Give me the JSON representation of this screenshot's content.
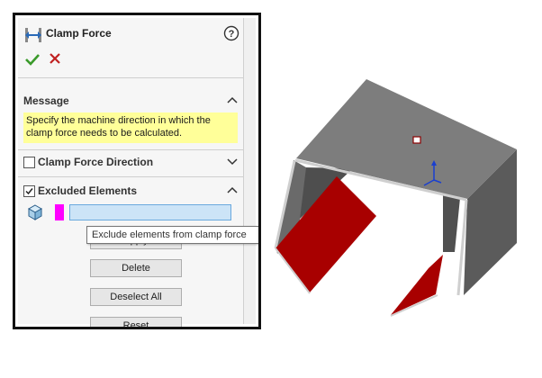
{
  "panel": {
    "title": "Clamp Force",
    "title_icon": "clamp-force-icon",
    "help_icon": "help-icon",
    "ok_icon": "checkmark-icon",
    "cancel_icon": "cancel-x-icon"
  },
  "message": {
    "header": "Message",
    "text": "Specify the machine direction in which the clamp force needs to be calculated."
  },
  "clamp_direction": {
    "label": "Clamp Force Direction",
    "checked": false
  },
  "excluded": {
    "label": "Excluded Elements",
    "checked": true,
    "selection_value": "",
    "tooltip": "Exclude elements from clamp force"
  },
  "buttons": {
    "apply": "Apply",
    "delete": "Delete",
    "deselect_all": "Deselect All",
    "reset": "Reset"
  },
  "colors": {
    "message_bg": "#ffff99",
    "selection_color": "#ff00ff",
    "field_bg": "#cce4f7",
    "part_gray": "#6e6e6e",
    "face_red": "#b30000"
  }
}
